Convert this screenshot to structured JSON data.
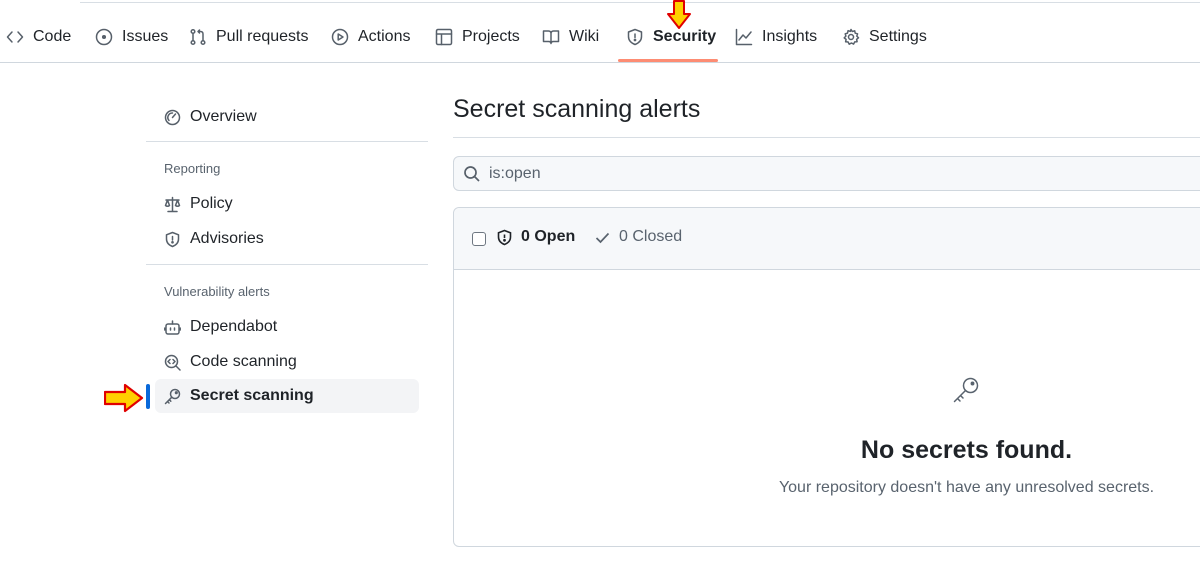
{
  "nav": {
    "tabs": [
      {
        "label": "Code",
        "icon": "code-icon"
      },
      {
        "label": "Issues",
        "icon": "issue-opened-icon"
      },
      {
        "label": "Pull requests",
        "icon": "git-pull-request-icon"
      },
      {
        "label": "Actions",
        "icon": "play-icon"
      },
      {
        "label": "Projects",
        "icon": "table-icon"
      },
      {
        "label": "Wiki",
        "icon": "book-icon"
      },
      {
        "label": "Security",
        "icon": "shield-icon",
        "active": true
      },
      {
        "label": "Insights",
        "icon": "graph-icon"
      },
      {
        "label": "Settings",
        "icon": "gear-icon"
      }
    ],
    "active_underline_color": "#fd8c73"
  },
  "sidebar": {
    "overview": "Overview",
    "reporting_heading": "Reporting",
    "policy": "Policy",
    "advisories": "Advisories",
    "vuln_heading": "Vulnerability alerts",
    "dependabot": "Dependabot",
    "code_scanning": "Code scanning",
    "secret_scanning": "Secret scanning",
    "selected_indicator_color": "#0969da"
  },
  "main": {
    "title": "Secret scanning alerts",
    "search": {
      "value": "is:open"
    },
    "filters": {
      "open": "0 Open",
      "closed": "0 Closed"
    },
    "empty": {
      "title": "No secrets found.",
      "description": "Your repository doesn't have any unresolved secrets."
    }
  },
  "annotations": {
    "arrow_color": "#ffd000",
    "arrow_outline": "#e00000"
  }
}
